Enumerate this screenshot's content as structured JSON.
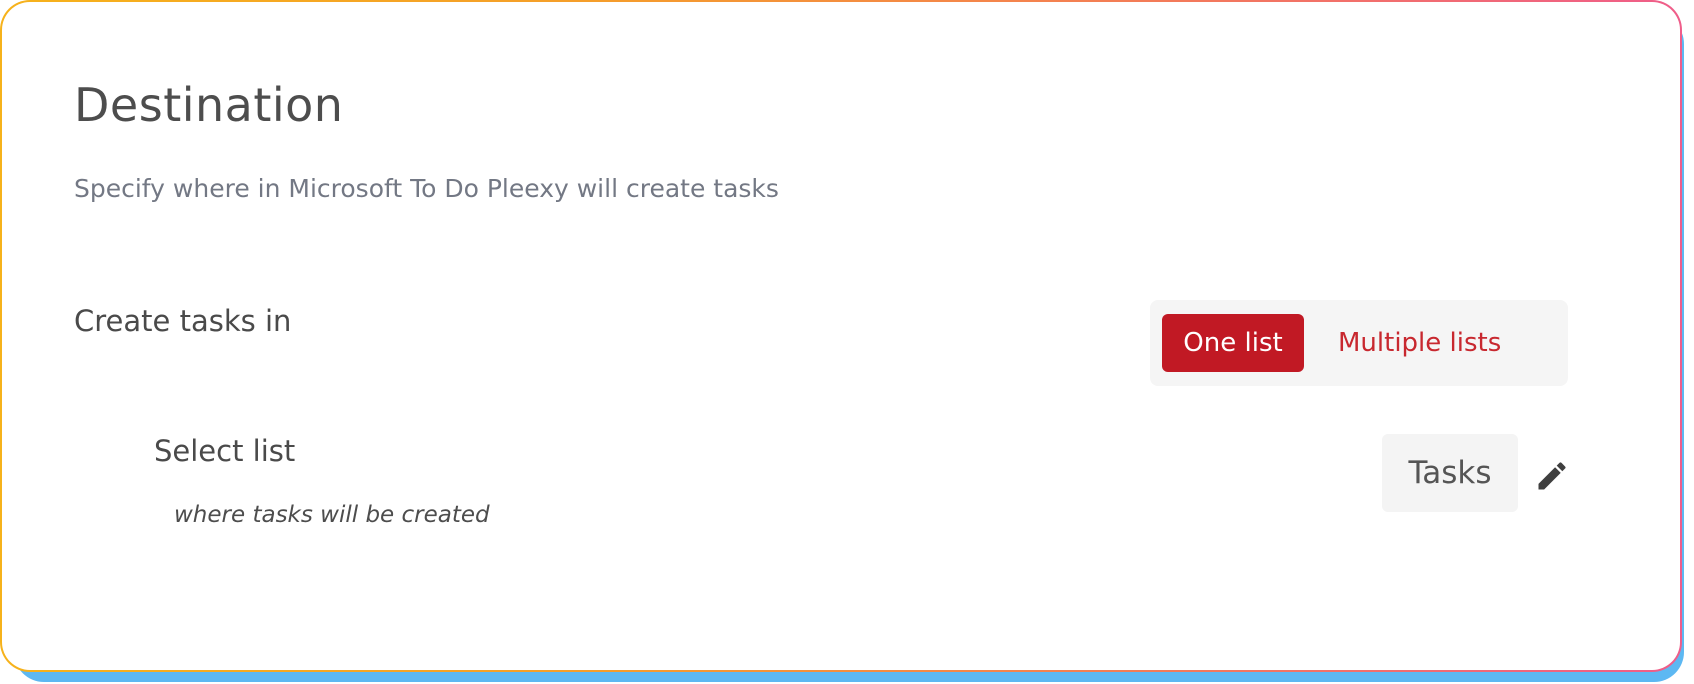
{
  "destination": {
    "title": "Destination",
    "subtitle": "Specify where in Microsoft To Do Pleexy will create tasks"
  },
  "create_tasks": {
    "label": "Create tasks in",
    "options": [
      {
        "label": "One list",
        "selected": true
      },
      {
        "label": "Multiple lists",
        "selected": false
      }
    ]
  },
  "select_list": {
    "label": "Select list",
    "hint": "where tasks will be created",
    "value": "Tasks",
    "edit_icon": "pencil-icon"
  },
  "colors": {
    "accent": "#c11924",
    "border_gradient_start": "#f6b21b",
    "border_gradient_end": "#ef5d8a",
    "shadow": "#5db8f2"
  }
}
